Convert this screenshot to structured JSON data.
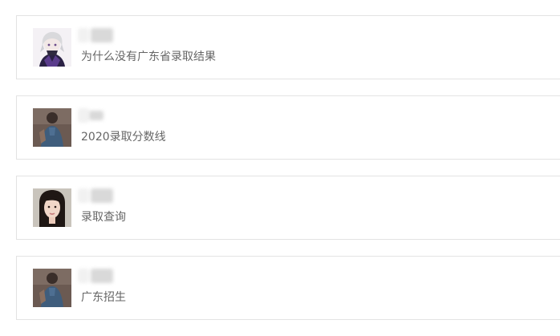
{
  "posts": [
    {
      "avatar": "anime-character-avatar",
      "question": "为什么没有广东省录取结果"
    },
    {
      "avatar": "person-photo-avatar",
      "question": "2020录取分数线"
    },
    {
      "avatar": "woman-portrait-avatar",
      "question": "录取查询"
    },
    {
      "avatar": "person-photo-avatar",
      "question": "广东招生"
    }
  ]
}
